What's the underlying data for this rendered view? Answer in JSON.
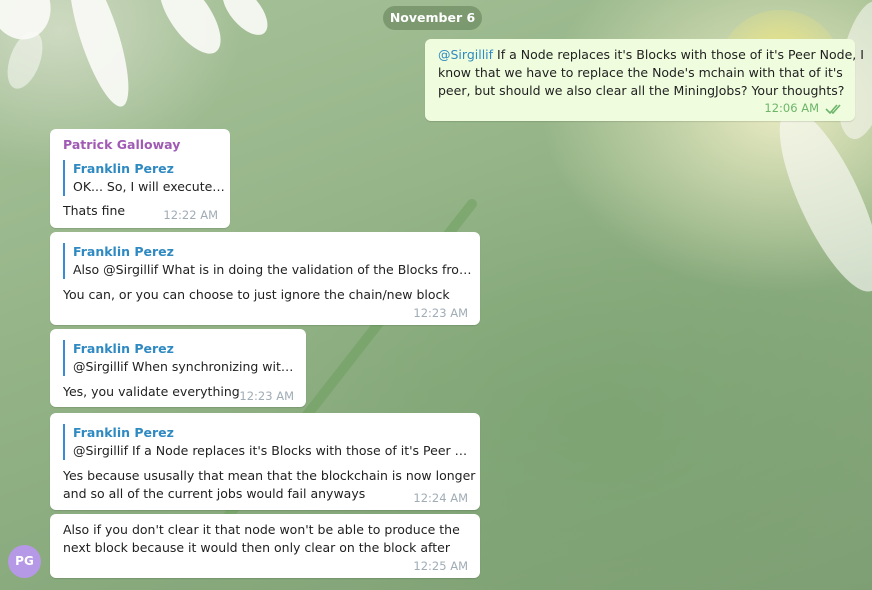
{
  "date": "November 6",
  "outgoing": {
    "mention": "@Sirgillif",
    "text_lines": [
      " If a Node replaces it's Blocks with those of it's Peer Node, I",
      "know that we have to replace the Node's mchain with that of it's",
      "peer, but should we also clear all the MiningJobs? Your thoughts?"
    ],
    "time": "12:06 AM",
    "status_icon": "double-check-icon"
  },
  "sender": {
    "name": "Patrick Galloway",
    "initials": "PG",
    "avatar_color": "#b699e6"
  },
  "messages": [
    {
      "reply_name": "Franklin Perez",
      "reply_text": "OK... So, I will execute i...",
      "lines": [
        "Thats fine"
      ],
      "time": "12:22 AM"
    },
    {
      "reply_name": "Franklin Perez",
      "reply_text": "Also @Sirgillif What is in doing the validation of the Blocks from a ...",
      "lines": [
        "You can, or you can choose to just ignore the chain/new block"
      ],
      "time": "12:23 AM"
    },
    {
      "reply_name": "Franklin Perez",
      "reply_text": "@Sirgillif When synchronizing with t...",
      "lines": [
        "Yes, you validate everything"
      ],
      "time": "12:23 AM"
    },
    {
      "reply_name": "Franklin Perez",
      "reply_text": "@Sirgillif If a Node replaces it's Blocks with those of it's Peer Nod...",
      "lines": [
        "Yes because ususally that mean that the blockchain is now longer",
        "and so all of the current jobs would fail anyways"
      ],
      "time": "12:24 AM"
    },
    {
      "lines": [
        "Also if you don't clear it that node won't be able to produce the",
        "next block because it would then only clear on the block after"
      ],
      "time": "12:25 AM"
    }
  ],
  "colors": {
    "outgoing_bubble": "#effdde",
    "incoming_bubble": "#ffffff",
    "sender_name": "#a05ab4",
    "reply_name": "#2f8ac2",
    "read_ticks": "#6db56a"
  }
}
